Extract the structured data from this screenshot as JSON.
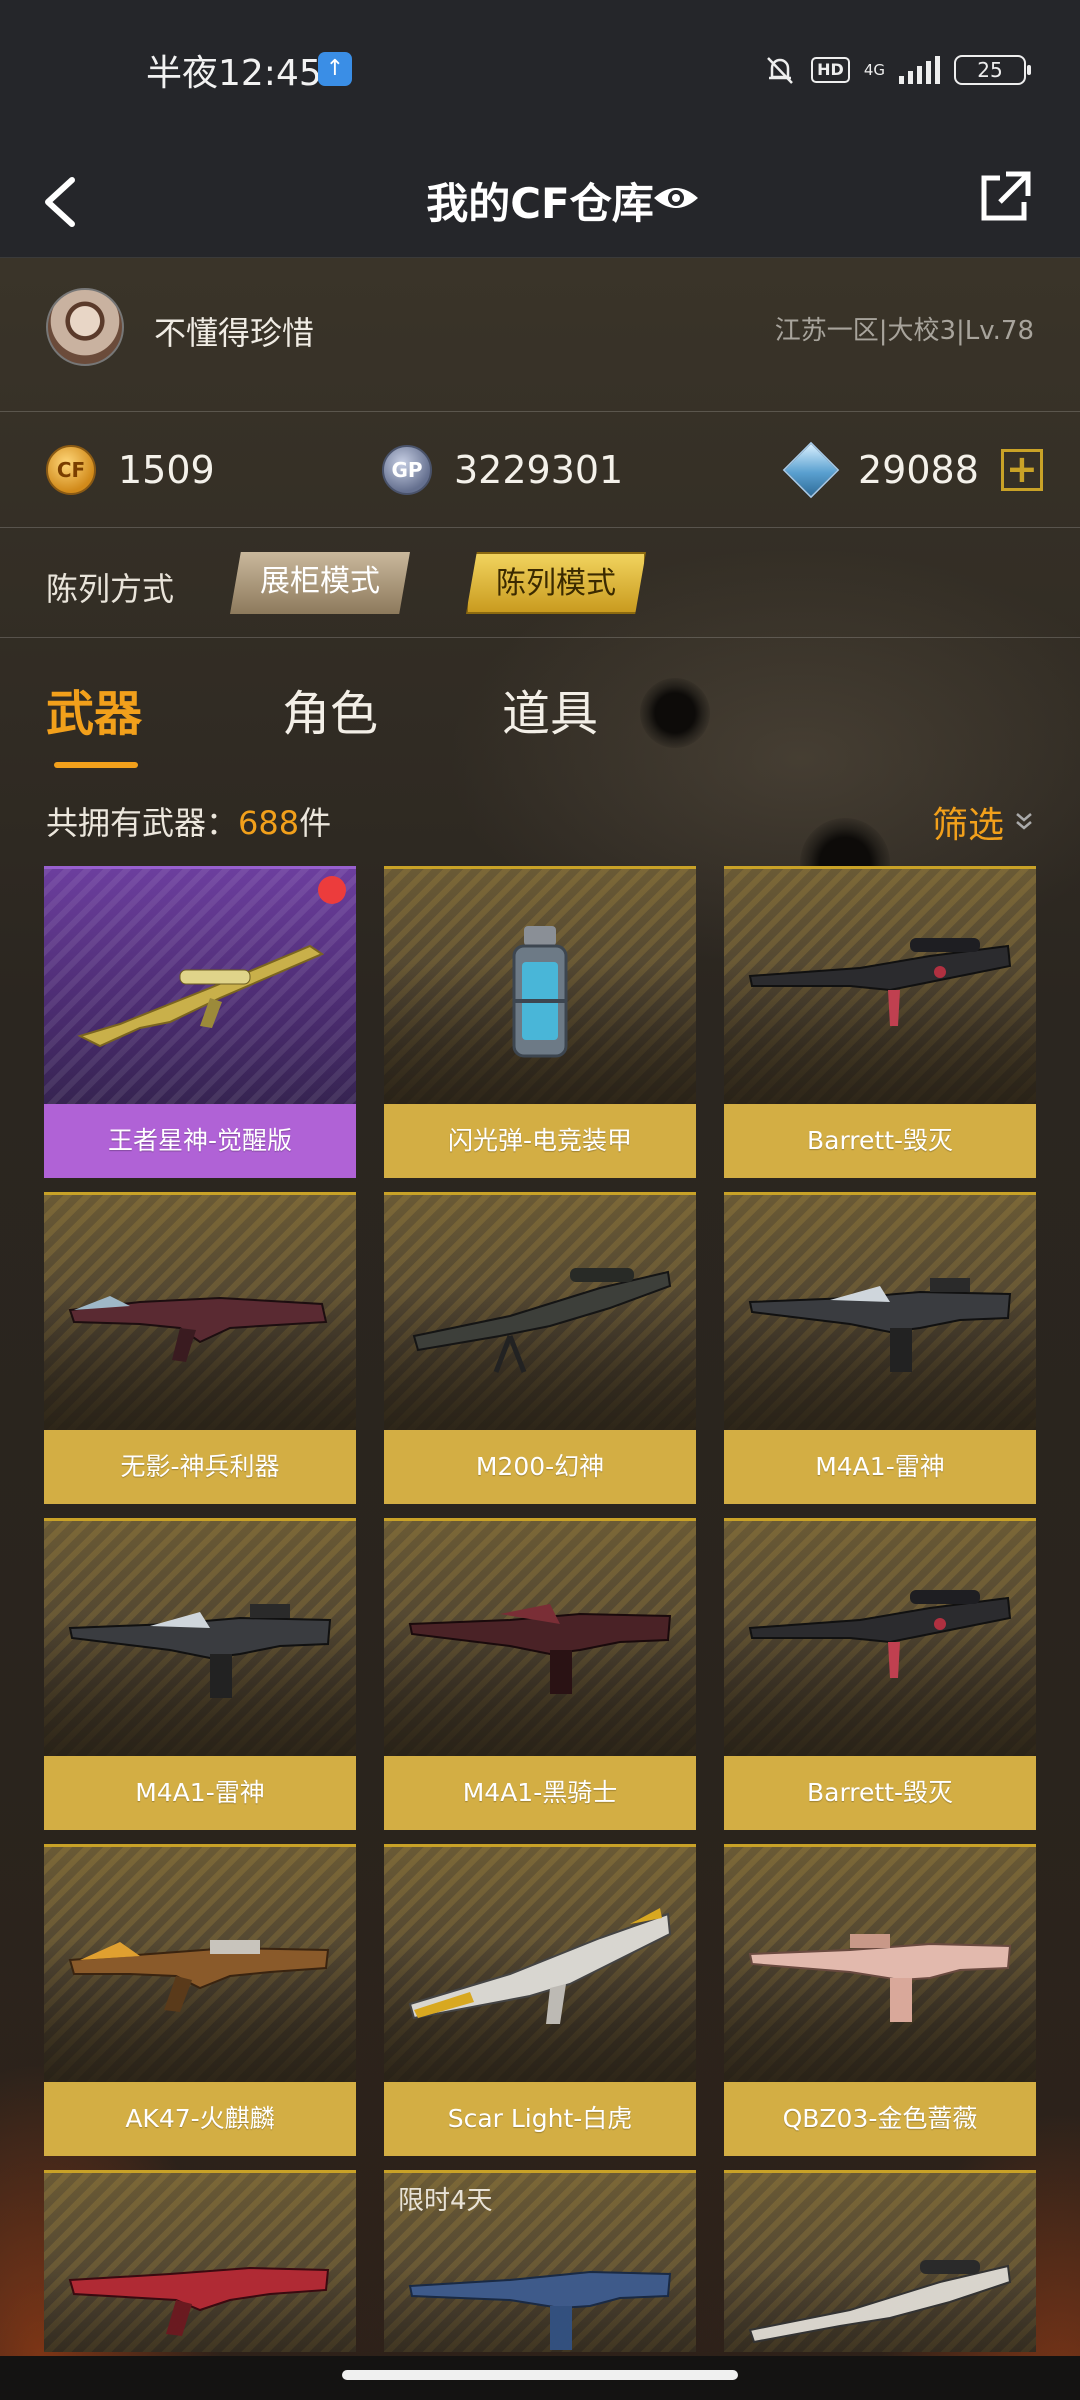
{
  "status_bar": {
    "time": "半夜12:45",
    "upload_glyph": "↑",
    "hd": "HD",
    "network": "4G",
    "battery": "25"
  },
  "header": {
    "title": "我的CF仓库",
    "back_icon": "chevron-left-icon",
    "share_icon": "external-share-icon"
  },
  "profile": {
    "nickname": "不懂得珍惜",
    "server_info": "江苏一区|大校3|Lv.78"
  },
  "currencies": {
    "cf_points": "1509",
    "gp": "3229301",
    "diamonds": "29088",
    "gp_badge": "GP",
    "cf_badge": "CF",
    "plus": "+"
  },
  "display_mode": {
    "label": "陈列方式",
    "options": [
      "展柜模式",
      "陈列模式"
    ],
    "selected": "陈列模式"
  },
  "tabs": [
    "武器",
    "角色",
    "道具"
  ],
  "active_tab": "武器",
  "inventory": {
    "count_label": "共拥有武器：",
    "count_value": "688",
    "count_unit": "件",
    "filter_label": "筛选"
  },
  "items": [
    {
      "name": "王者星神-觉醒版",
      "rarity": "purple",
      "new": true
    },
    {
      "name": "闪光弹-电竞装甲",
      "rarity": "gold"
    },
    {
      "name": "Barrett-毁灭",
      "rarity": "gold"
    },
    {
      "name": "无影-神兵利器",
      "rarity": "gold"
    },
    {
      "name": "M200-幻神",
      "rarity": "gold"
    },
    {
      "name": "M4A1-雷神",
      "rarity": "gold"
    },
    {
      "name": "M4A1-雷神",
      "rarity": "gold"
    },
    {
      "name": "M4A1-黑骑士",
      "rarity": "gold"
    },
    {
      "name": "Barrett-毁灭",
      "rarity": "gold"
    },
    {
      "name": "AK47-火麒麟",
      "rarity": "gold"
    },
    {
      "name": "Scar Light-白虎",
      "rarity": "gold"
    },
    {
      "name": "QBZ03-金色蔷薇",
      "rarity": "gold"
    }
  ],
  "partial_items": [
    {
      "tag": ""
    },
    {
      "tag": "限时4天"
    },
    {
      "tag": ""
    }
  ],
  "colors": {
    "accent": "#f2a01b",
    "gold_label": "#d3ae44",
    "purple_label": "#b062d6",
    "header_bg": "#25262a"
  }
}
